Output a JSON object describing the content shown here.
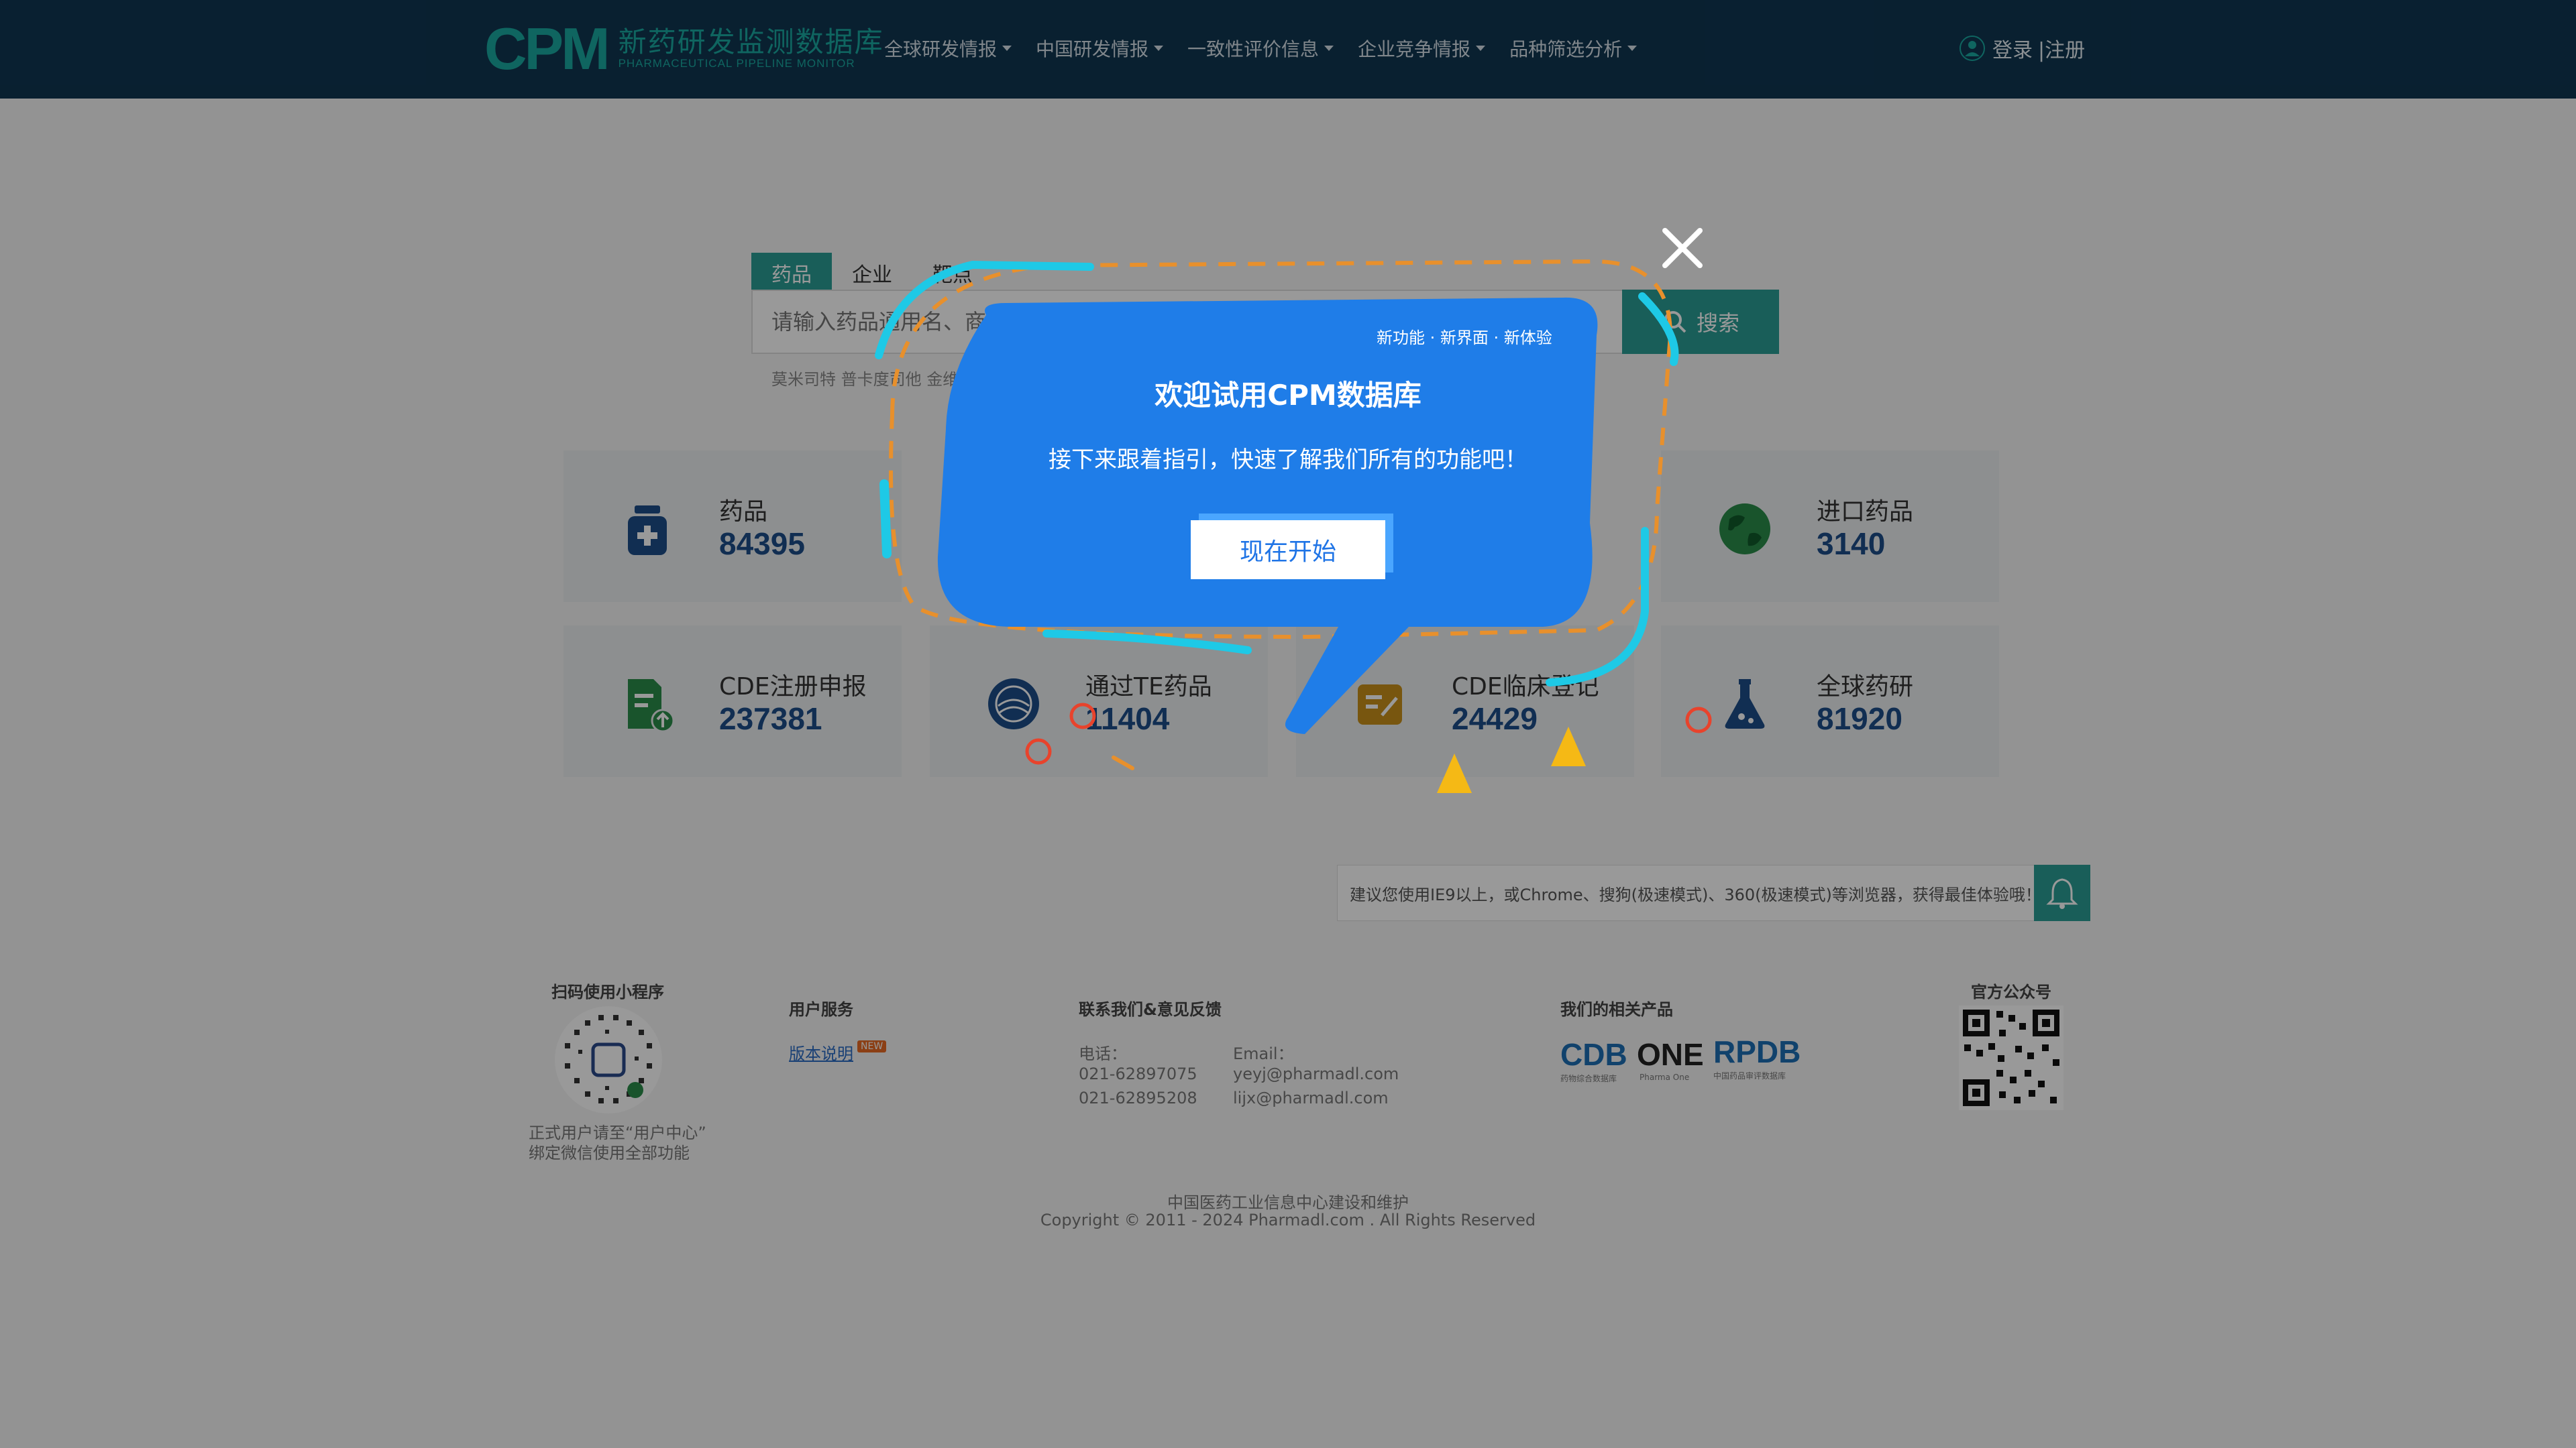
{
  "header": {
    "logo_mark": "CPM",
    "logo_cn": "新药研发监测数据库",
    "logo_en": "PHARMACEUTICAL PIPELINE MONITOR",
    "nav": [
      "全球研发情报",
      "中国研发情报",
      "一致性评价信息",
      "企业竞争情报",
      "品种筛选分析"
    ],
    "login": "登录",
    "register": "|注册"
  },
  "search": {
    "tabs": [
      "药品",
      "企业",
      "靶点"
    ],
    "placeholder": "请输入药品通用名、商品名",
    "button": "搜索",
    "hot_words": "莫米司特  普卡度司他  金维"
  },
  "cards": [
    {
      "label": "药品",
      "value": "84395"
    },
    {
      "label": "进口药品",
      "value": "3140"
    },
    {
      "label": "CDE注册申报",
      "value": "237381"
    },
    {
      "label": "通过TE药品",
      "value": "11404"
    },
    {
      "label": "CDE临床登记",
      "value": "24429"
    },
    {
      "label": "全球药研",
      "value": "81920"
    }
  ],
  "tip": "建议您使用IE9以上，或Chrome、搜狗(极速模式)、360(极速模式)等浏览器，获得最佳体验哦！",
  "footer": {
    "miniapp_title": "扫码使用小程序",
    "miniapp_note1": "正式用户请至“用户中心”",
    "miniapp_note2": "绑定微信使用全部功能",
    "service_title": "用户服务",
    "service_link": "版本说明",
    "new_badge": "NEW",
    "contact_title": "联系我们&意见反馈",
    "phone_label": "电话：",
    "phone1": "021-62897075",
    "phone2": "021-62895208",
    "email_label": "Email：",
    "email1": "yeyj@pharmadl.com",
    "email2": "lijx@pharmadl.com",
    "products_title": "我们的相关产品",
    "products": [
      "CDB",
      "ONE",
      "RPDB"
    ],
    "product_notes": [
      "药物综合数据库",
      "Pharma One",
      "中国药品审评数据库"
    ],
    "official_title": "官方公众号",
    "credit": "中国医药工业信息中心建设和维护",
    "copyright": "Copyright © 2011 - 2024 Pharmadl.com . All Rights Reserved"
  },
  "guide": {
    "tagline": "新功能 · 新界面 · 新体验",
    "title": "欢迎试用CPM数据库",
    "subtitle": "接下来跟着指引，快速了解我们所有的功能吧！",
    "start_button": "现在开始",
    "close_label": "×"
  },
  "colors": {
    "header_bg": "#0f3651",
    "brand_teal": "#2a9d94",
    "bubble_blue": "#1f74e6",
    "accent_cyan": "#1ec9e6",
    "accent_orange": "#e8902c",
    "accent_red": "#e8432c",
    "triangle_yellow": "#f5b915"
  }
}
